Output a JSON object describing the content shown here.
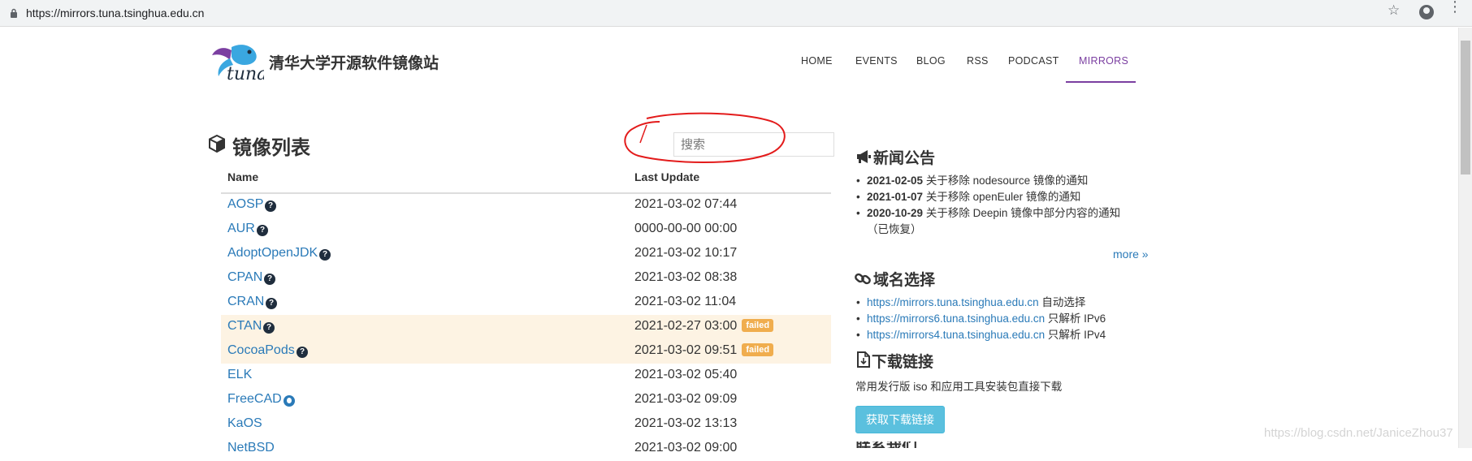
{
  "browser": {
    "url": "https://mirrors.tuna.tsinghua.edu.cn"
  },
  "header": {
    "site_title": "清华大学开源软件镜像站",
    "logo_text": "tuna",
    "nav": [
      {
        "label": "HOME",
        "active": false
      },
      {
        "label": "EVENTS",
        "active": false
      },
      {
        "label": "BLOG",
        "active": false
      },
      {
        "label": "RSS",
        "active": false
      },
      {
        "label": "PODCAST",
        "active": false
      },
      {
        "label": "MIRRORS",
        "active": true
      }
    ],
    "accent_color": "#7b3fa1"
  },
  "mirrors": {
    "title": "镜像列表",
    "search_placeholder": "搜索",
    "columns": {
      "name": "Name",
      "last_update": "Last Update"
    },
    "rows": [
      {
        "name": "AOSP",
        "icon": "help-icon",
        "date": "2021-03-02 07:44",
        "status": ""
      },
      {
        "name": "AUR",
        "icon": "help-icon",
        "date": "0000-00-00 00:00",
        "status": ""
      },
      {
        "name": "AdoptOpenJDK",
        "icon": "help-icon",
        "date": "2021-03-02 10:17",
        "status": ""
      },
      {
        "name": "CPAN",
        "icon": "help-icon",
        "date": "2021-03-02 08:38",
        "status": ""
      },
      {
        "name": "CRAN",
        "icon": "help-icon",
        "date": "2021-03-02 11:04",
        "status": ""
      },
      {
        "name": "CTAN",
        "icon": "help-icon",
        "date": "2021-02-27 03:00",
        "status": "failed"
      },
      {
        "name": "CocoaPods",
        "icon": "help-icon",
        "date": "2021-03-02 09:51",
        "status": "failed"
      },
      {
        "name": "ELK",
        "icon": "",
        "date": "2021-03-02 05:40",
        "status": ""
      },
      {
        "name": "FreeCAD",
        "icon": "github-icon",
        "date": "2021-03-02 09:09",
        "status": ""
      },
      {
        "name": "KaOS",
        "icon": "",
        "date": "2021-03-02 13:13",
        "status": ""
      },
      {
        "name": "NetBSD",
        "icon": "",
        "date": "2021-03-02 09:00",
        "status": ""
      }
    ],
    "failed_badge_color": "#f0ad4e",
    "failed_row_color": "#fdf3e3"
  },
  "news": {
    "title": "新闻公告",
    "items": [
      {
        "date": "2021-02-05",
        "text": "关于移除 nodesource 镜像的通知"
      },
      {
        "date": "2021-01-07",
        "text": "关于移除 openEuler 镜像的通知"
      },
      {
        "date": "2020-10-29",
        "text": "关于移除 Deepin 镜像中部分内容的通知",
        "text2": "（已恢复）"
      }
    ],
    "more": "more »"
  },
  "domains": {
    "title": "域名选择",
    "items": [
      {
        "url": "https://mirrors.tuna.tsinghua.edu.cn",
        "note": "自动选择"
      },
      {
        "url": "https://mirrors6.tuna.tsinghua.edu.cn",
        "note": "只解析 IPv6"
      },
      {
        "url": "https://mirrors4.tuna.tsinghua.edu.cn",
        "note": "只解析 IPv4"
      }
    ]
  },
  "download": {
    "title": "下载链接",
    "description": "常用发行版 iso 和应用工具安装包直接下载",
    "button": "获取下载链接"
  },
  "contact": {
    "title": "联系我们"
  },
  "watermark": "https://blog.csdn.net/JaniceZhou37"
}
